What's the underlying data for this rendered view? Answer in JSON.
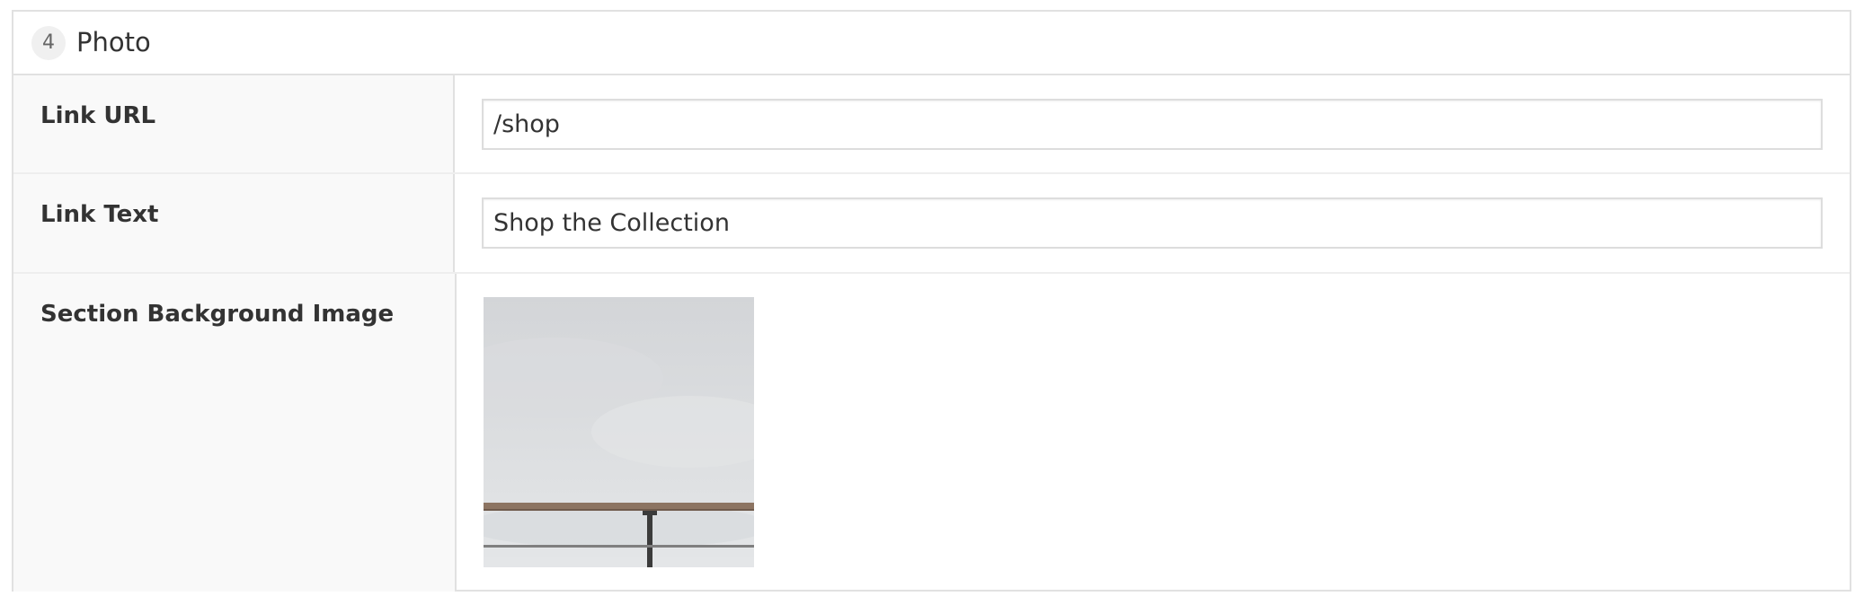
{
  "layout_block": {
    "order": "4",
    "title": "Photo"
  },
  "fields": {
    "link_url": {
      "label": "Link URL",
      "value": "/shop"
    },
    "link_text": {
      "label": "Link Text",
      "value": "Shop the Collection"
    },
    "background_image": {
      "label": "Section Background Image",
      "icon": "image-thumbnail"
    }
  },
  "colors": {
    "border": "#e1e1e1",
    "label_bg": "#f9f9f9",
    "text": "#333333",
    "badge_bg": "#f0f0f0"
  }
}
